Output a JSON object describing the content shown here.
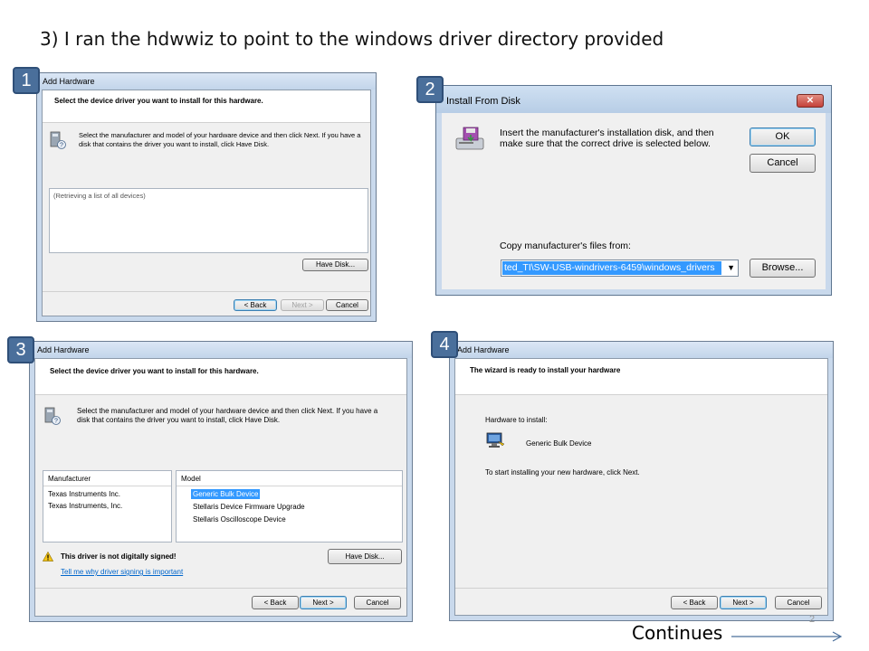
{
  "slide": {
    "title": "3) I ran the hdwwiz to point to the windows driver directory provided",
    "page_number": "2",
    "continues": "Continues"
  },
  "badges": [
    "1",
    "2",
    "3",
    "4"
  ],
  "win1": {
    "title": "Add Hardware",
    "header": "Select the device driver you want to install for this hardware.",
    "desc1": "Select the manufacturer and model of your hardware device and then click Next. If you have a",
    "desc2": "disk that contains the driver you want to install, click Have Disk.",
    "list_status": "(Retrieving a list of all devices)",
    "have_disk": "Have Disk...",
    "back": "< Back",
    "next": "Next >",
    "cancel": "Cancel"
  },
  "win2": {
    "title": "Install From Disk",
    "message1": "Insert the manufacturer's installation disk, and then",
    "message2": "make sure that the correct drive is selected below.",
    "ok": "OK",
    "cancel": "Cancel",
    "copy_label": "Copy manufacturer's files from:",
    "path_value": "ted_TI\\SW-USB-windrivers-6459\\windows_drivers",
    "browse": "Browse..."
  },
  "win3": {
    "title": "Add Hardware",
    "header": "Select the device driver you want to install for this hardware.",
    "desc1": "Select the manufacturer and model of your hardware device and then click Next. If you have a",
    "desc2": "disk that contains the driver you want to install, click Have Disk.",
    "manufacturer_header": "Manufacturer",
    "manufacturers": [
      "Texas Instruments Inc.",
      "Texas Instruments, Inc."
    ],
    "model_header": "Model",
    "models": [
      "Generic Bulk Device",
      "Stellaris Device Firmware Upgrade",
      "Stellaris Oscilloscope Device"
    ],
    "warning": "This driver is not digitally signed!",
    "link": "Tell me why driver signing is important",
    "have_disk": "Have Disk...",
    "back": "< Back",
    "next": "Next >",
    "cancel": "Cancel"
  },
  "win4": {
    "title": "Add Hardware",
    "header": "The wizard is ready to install your hardware",
    "hw_label": "Hardware to install:",
    "device": "Generic Bulk Device",
    "instruction": "To start installing your new hardware, click Next.",
    "back": "< Back",
    "next": "Next >",
    "cancel": "Cancel"
  },
  "colors": {
    "badge": "#4a6f9b",
    "selection": "#3399ff",
    "link": "#0066cc",
    "close_button": "#c4413a"
  }
}
